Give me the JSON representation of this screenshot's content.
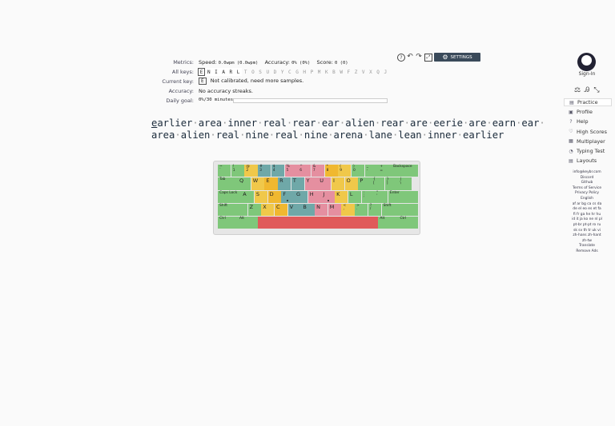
{
  "metrics": {
    "label": "Metrics:",
    "speed_label": "Speed:",
    "speed_value": "0.0wpm (0.0wpm)",
    "accuracy_label": "Accuracy:",
    "accuracy_value": "0% (0%)",
    "score_label": "Score:",
    "score_value": "0 (0)"
  },
  "all_keys": {
    "label": "All keys:",
    "keys": [
      "E",
      "N",
      "I",
      "A",
      "R",
      "L",
      "T",
      "O",
      "S",
      "U",
      "D",
      "Y",
      "C",
      "G",
      "H",
      "P",
      "M",
      "K",
      "B",
      "W",
      "F",
      "Z",
      "V",
      "X",
      "Q",
      "J"
    ]
  },
  "current_key": {
    "label": "Current key:",
    "key": "E",
    "text": "Not calibrated, need more samples."
  },
  "accuracy": {
    "label": "Accuracy:",
    "text": "No accuracy streaks."
  },
  "daily_goal": {
    "label": "Daily goal:",
    "value": "0%/30 minutes",
    "progress": 0
  },
  "toolbar": {
    "settings_label": "SETTINGS"
  },
  "lesson": {
    "line1": [
      "earlier",
      "area",
      "inner",
      "real",
      "rear",
      "ear",
      "alien",
      "rear",
      "are",
      "eerie",
      "are",
      "earn",
      "ear"
    ],
    "line2": [
      "area",
      "alien",
      "real",
      "nine",
      "real",
      "nine",
      "arena",
      "lane",
      "lean",
      "inner",
      "earlier"
    ],
    "separator": "·"
  },
  "keyboard": {
    "row0": [
      {
        "top": "~",
        "bot": "`"
      },
      {
        "top": "!",
        "bot": "1"
      },
      {
        "top": "@",
        "bot": "2"
      },
      {
        "top": "#",
        "bot": "3"
      },
      {
        "top": "$",
        "bot": "4"
      },
      {
        "top": "%",
        "bot": "5"
      },
      {
        "top": "^",
        "bot": "6"
      },
      {
        "top": "&",
        "bot": "7"
      },
      {
        "top": "*",
        "bot": "8"
      },
      {
        "top": "(",
        "bot": "9"
      },
      {
        "top": ")",
        "bot": "0"
      },
      {
        "top": "_",
        "bot": "-"
      },
      {
        "top": "+",
        "bot": "="
      }
    ],
    "backspace": "Backspace",
    "tab": "Tab",
    "row1": [
      "Q",
      "W",
      "E",
      "R",
      "T",
      "Y",
      "U",
      "I",
      "O",
      "P"
    ],
    "row1_extra": [
      {
        "top": "{",
        "bot": "["
      },
      {
        "top": "}",
        "bot": "]"
      },
      {
        "top": "|",
        "bot": "\\"
      }
    ],
    "capslock": "Caps Lock",
    "row2": [
      "A",
      "S",
      "D",
      "F",
      "G",
      "H",
      "J",
      "K",
      "L"
    ],
    "row2_extra": [
      {
        "top": ":",
        "bot": ";"
      },
      {
        "top": "\"",
        "bot": "'"
      }
    ],
    "enter": "Enter",
    "shift_left": "Shift",
    "row3": [
      "Z",
      "X",
      "C",
      "V",
      "B",
      "N",
      "M"
    ],
    "row3_extra": [
      {
        "top": "<",
        "bot": ","
      },
      {
        "top": ">",
        "bot": "."
      },
      {
        "top": "?",
        "bot": "/"
      }
    ],
    "shift_right": "Shift",
    "ctrl_left": "Ctrl",
    "alt_left": "Alt",
    "alt_right": "Alt",
    "ctrl_right": "Ctrl"
  },
  "sidebar": {
    "signin": "Sign-In",
    "menu": [
      {
        "label": "Practice",
        "icon": "practice-icon",
        "glyph": "▤"
      },
      {
        "label": "Profile",
        "icon": "profile-icon",
        "glyph": "▣"
      },
      {
        "label": "Help",
        "icon": "help-icon",
        "glyph": "?"
      },
      {
        "label": "High Scores",
        "icon": "high-scores-icon",
        "glyph": "♡"
      },
      {
        "label": "Multiplayer",
        "icon": "multiplayer-icon",
        "glyph": "▦"
      },
      {
        "label": "Typing Test",
        "icon": "typing-test-icon",
        "glyph": "◔"
      },
      {
        "label": "Layouts",
        "icon": "layouts-icon",
        "glyph": "▤"
      }
    ],
    "footer": [
      "info@keybr.com",
      "Discord",
      "Github",
      "Terms of Service",
      "Privacy Policy",
      "English",
      "af ar bg ca cs da",
      "de el eo es et fa",
      "fi fr ga he hr hu",
      "id it ja ko ne nl pl",
      "pt-br pt-pt ro ru",
      "sk sv th tr uk vi",
      "zh-hans zh-hant",
      "zh-tw",
      "Translate",
      "Remove Ads"
    ]
  }
}
